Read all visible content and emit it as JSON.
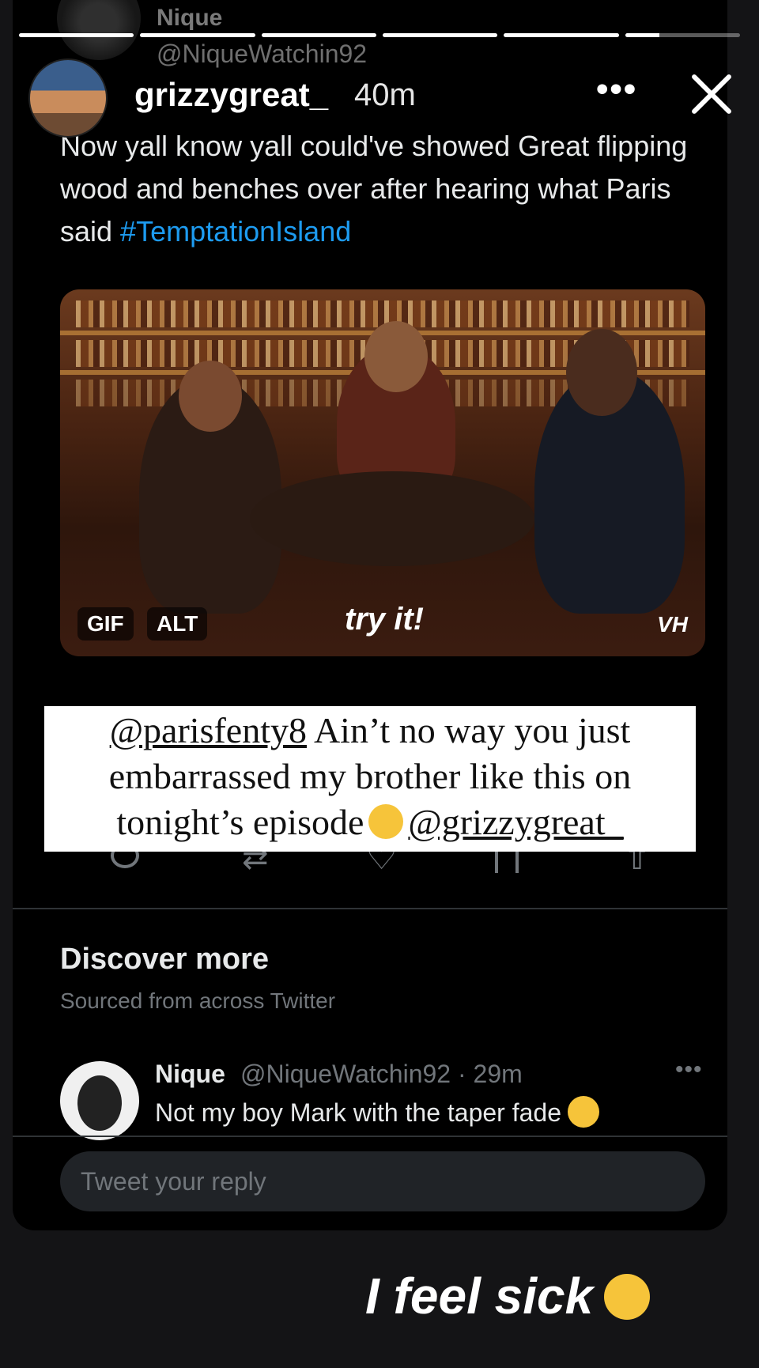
{
  "progress": [
    1,
    1,
    1,
    1,
    1,
    0.3
  ],
  "quoted_header": {
    "name": "Nique",
    "handle": "@NiqueWatchin92"
  },
  "story": {
    "username": "grizzygreat_",
    "time": "40m",
    "more": "•••"
  },
  "tweet": {
    "text": "Now yall know yall could've showed Great flipping wood and benches over after hearing what Paris said ",
    "hashtag": "#TemptationIsland"
  },
  "media": {
    "gif_badge": "GIF",
    "alt_badge": "ALT",
    "caption": "try it!",
    "logo": "VH"
  },
  "overlay": {
    "mention1": "@parisfenty8",
    "line1_rest": " Ain’t no way you just",
    "line2": "embarrassed my brother like this on",
    "line3_start": "tonight’s episode",
    "mention2": "@grizzygreat_"
  },
  "discover": {
    "title": "Discover more",
    "subtitle": "Sourced from across Twitter"
  },
  "recommended": {
    "name": "Nique",
    "meta": "@NiqueWatchin92 · 29m",
    "text": "Not my boy Mark with the taper fade"
  },
  "reply": {
    "placeholder": "Tweet your reply"
  },
  "story_caption": "I feel sick"
}
